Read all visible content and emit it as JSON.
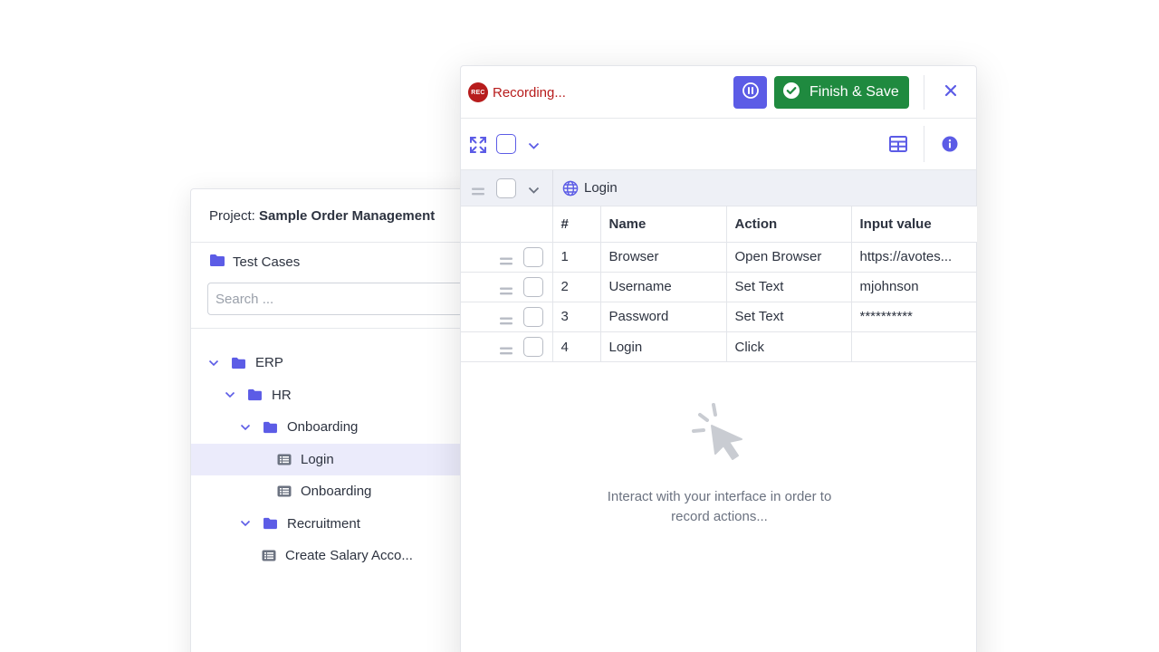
{
  "project": {
    "label": "Project:",
    "name": "Sample Order Management",
    "test_cases_title": "Test Cases",
    "search_placeholder": "Search ...",
    "tree": [
      {
        "label": "ERP",
        "type": "folder",
        "level": 0,
        "expanded": true
      },
      {
        "label": "HR",
        "type": "folder",
        "level": 1,
        "expanded": true
      },
      {
        "label": "Onboarding",
        "type": "folder",
        "level": 2,
        "expanded": true
      },
      {
        "label": "Login",
        "type": "testcase",
        "level": 3,
        "selected": true
      },
      {
        "label": "Onboarding",
        "type": "testcase",
        "level": 3
      },
      {
        "label": "Recruitment",
        "type": "folder",
        "level": 2,
        "expanded": true
      },
      {
        "label": "Create Salary Acco...",
        "type": "testcase",
        "level": 2
      }
    ]
  },
  "recorder": {
    "rec_badge": "REC",
    "status": "Recording...",
    "finish_label": "Finish & Save",
    "group_title": "Login",
    "columns": [
      "#",
      "Name",
      "Action",
      "Input value"
    ],
    "steps": [
      {
        "num": "1",
        "name": "Browser",
        "action": "Open Browser",
        "input": "https://avotes..."
      },
      {
        "num": "2",
        "name": "Username",
        "action": "Set Text",
        "input": "mjohnson"
      },
      {
        "num": "3",
        "name": "Password",
        "action": "Set Text",
        "input": "**********"
      },
      {
        "num": "4",
        "name": "Login",
        "action": "Click",
        "input": ""
      }
    ],
    "empty_line1": "Interact with your interface in order to",
    "empty_line2": "record actions..."
  },
  "colors": {
    "accent": "#5c5ce6",
    "recording_red": "#b71c1c",
    "finish_green": "#1f8a3f",
    "selected_row": "#ebebfb"
  }
}
